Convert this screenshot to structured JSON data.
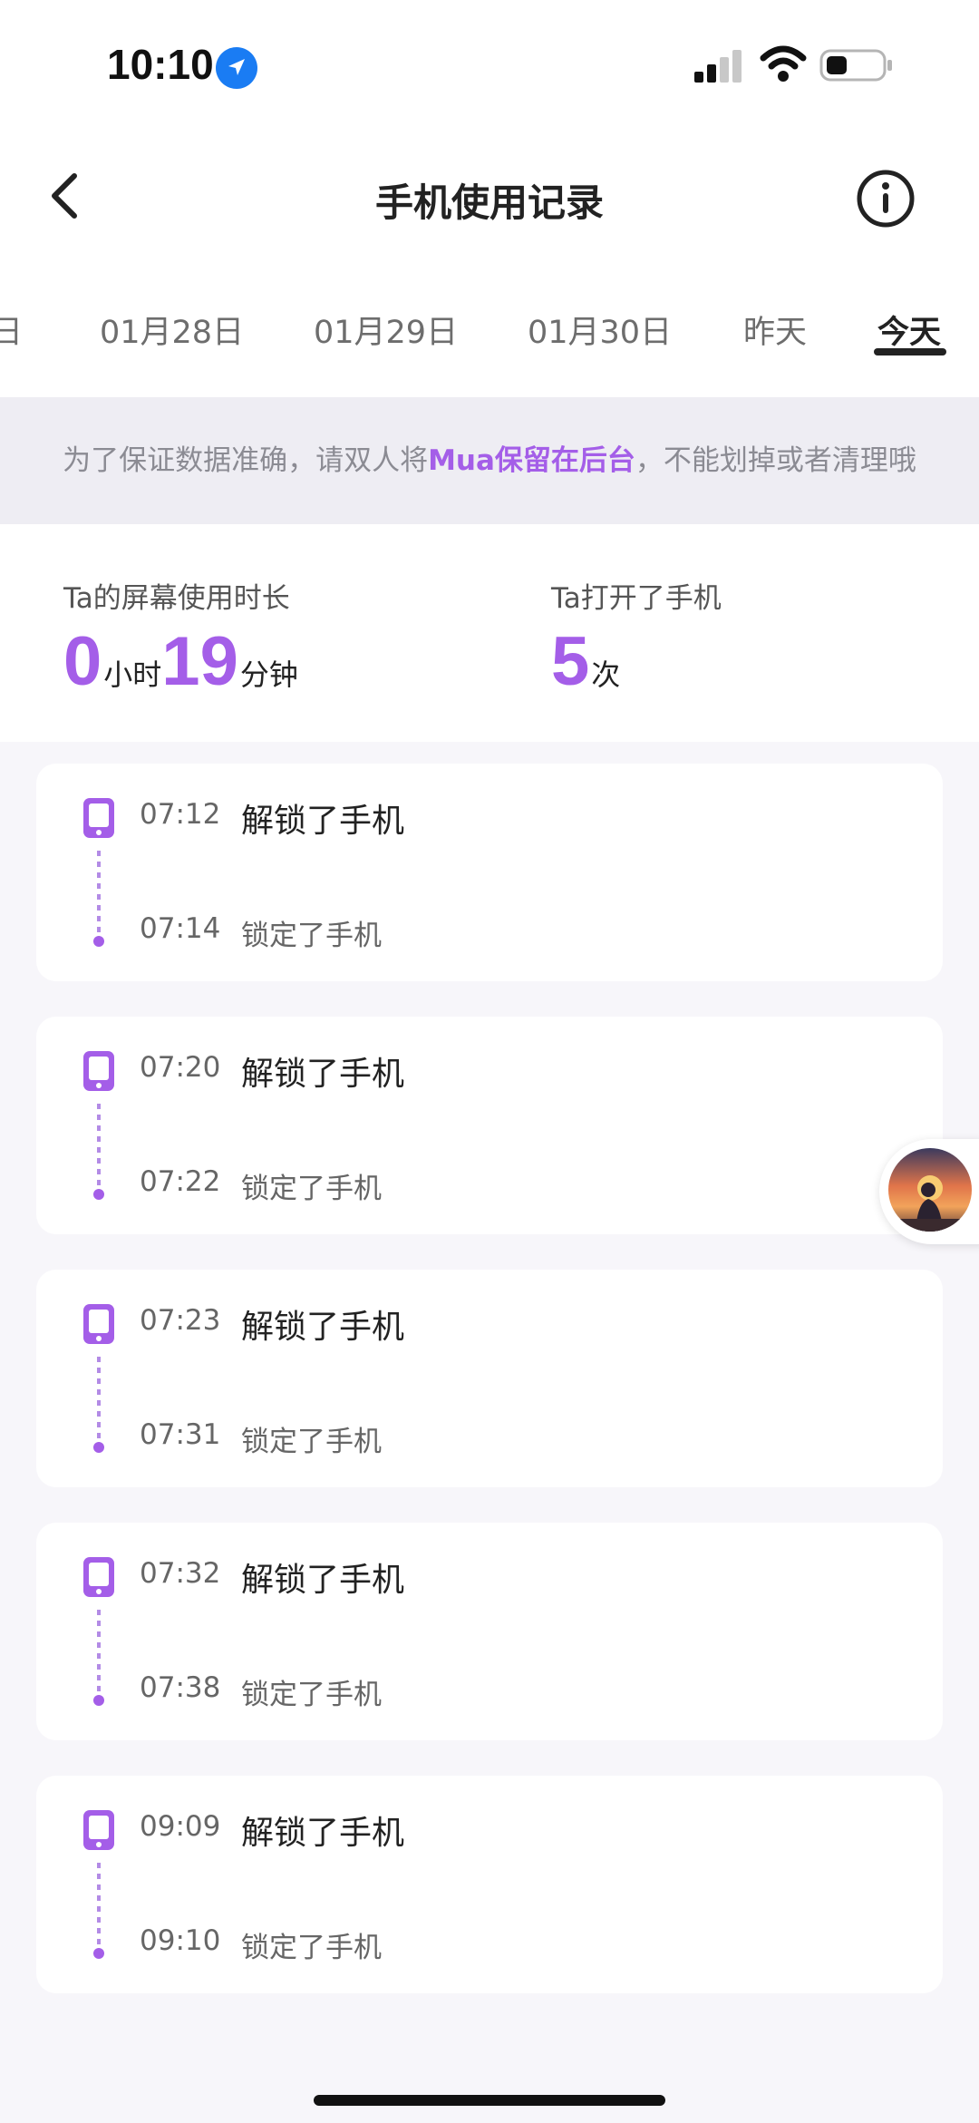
{
  "status_bar": {
    "time": "10:10"
  },
  "header": {
    "title": "手机使用记录"
  },
  "tabs": [
    {
      "label": "日",
      "active": false
    },
    {
      "label": "01月28日",
      "active": false
    },
    {
      "label": "01月29日",
      "active": false
    },
    {
      "label": "01月30日",
      "active": false
    },
    {
      "label": "昨天",
      "active": false
    },
    {
      "label": "今天",
      "active": true
    }
  ],
  "notice": {
    "prefix": "为了保证数据准确，请双人将",
    "highlight": "Mua保留在后台",
    "suffix": "，不能划掉或者清理哦"
  },
  "stats": {
    "screen_time_label": "Ta的屏幕使用时长",
    "hours": "0",
    "hours_unit": "小时",
    "minutes": "19",
    "minutes_unit": "分钟",
    "opens_label": "Ta打开了手机",
    "opens": "5",
    "opens_unit": "次"
  },
  "records": [
    {
      "unlock_time": "07:12",
      "unlock_text": "解锁了手机",
      "lock_time": "07:14",
      "lock_text": "锁定了手机"
    },
    {
      "unlock_time": "07:20",
      "unlock_text": "解锁了手机",
      "lock_time": "07:22",
      "lock_text": "锁定了手机"
    },
    {
      "unlock_time": "07:23",
      "unlock_text": "解锁了手机",
      "lock_time": "07:31",
      "lock_text": "锁定了手机"
    },
    {
      "unlock_time": "07:32",
      "unlock_text": "解锁了手机",
      "lock_time": "07:38",
      "lock_text": "锁定了手机"
    },
    {
      "unlock_time": "09:09",
      "unlock_text": "解锁了手机",
      "lock_time": "09:10",
      "lock_text": "锁定了手机"
    }
  ],
  "colors": {
    "accent": "#a45ee8",
    "background": "#f7f6fa",
    "notice_bg": "#eeedf3"
  },
  "icons": {
    "status": [
      "location-icon",
      "signal-icon",
      "wifi-icon",
      "battery-icon"
    ],
    "header": [
      "back-icon",
      "info-icon"
    ],
    "record": "phone-icon",
    "floating": "avatar"
  }
}
